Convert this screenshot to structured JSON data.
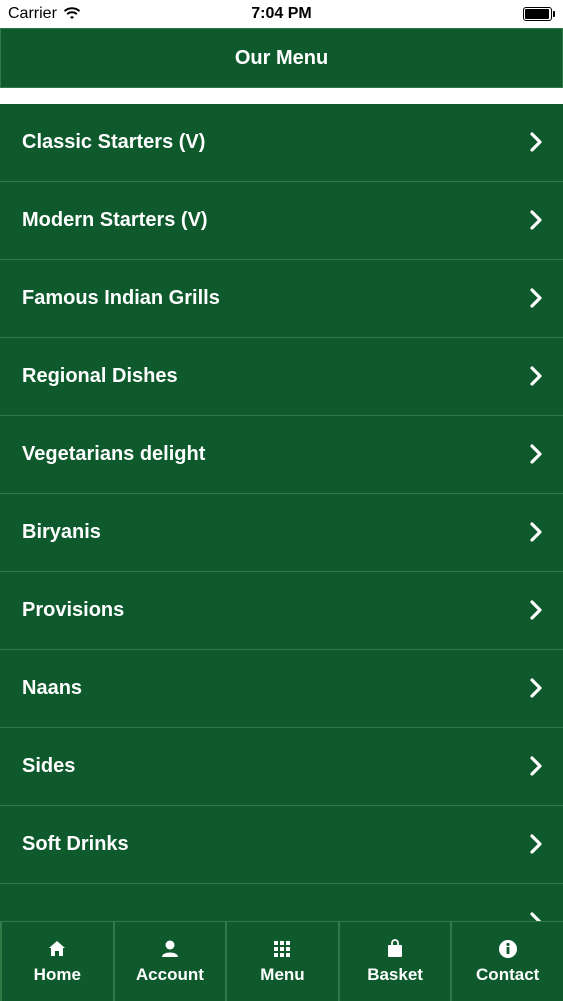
{
  "status_bar": {
    "carrier": "Carrier",
    "time": "7:04 PM"
  },
  "header": {
    "title": "Our Menu"
  },
  "menu_items": [
    {
      "label": "Classic Starters (V)"
    },
    {
      "label": "Modern Starters (V)"
    },
    {
      "label": "Famous Indian Grills"
    },
    {
      "label": "Regional Dishes"
    },
    {
      "label": "Vegetarians delight"
    },
    {
      "label": "Biryanis"
    },
    {
      "label": "Provisions"
    },
    {
      "label": "Naans"
    },
    {
      "label": "Sides"
    },
    {
      "label": "Soft Drinks"
    },
    {
      "label": ""
    }
  ],
  "tabs": [
    {
      "label": "Home",
      "icon": "home-icon"
    },
    {
      "label": "Account",
      "icon": "user-icon"
    },
    {
      "label": "Menu",
      "icon": "grid-icon"
    },
    {
      "label": "Basket",
      "icon": "bag-icon"
    },
    {
      "label": "Contact",
      "icon": "info-icon"
    }
  ],
  "colors": {
    "primary": "#0e5a2d",
    "divider": "#2f7a46",
    "text": "#ffffff"
  }
}
